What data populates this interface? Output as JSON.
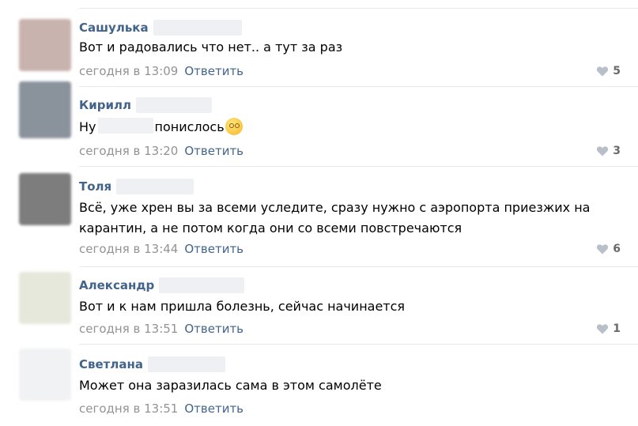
{
  "comments": [
    {
      "author": "Сашулька",
      "text": "Вот и радовались что нет.. а тут за раз",
      "timestamp": "сегодня в 13:09",
      "reply_label": "Ответить",
      "likes": "5",
      "avatar_color": "#c9b3ae"
    },
    {
      "author": "Кирилл",
      "text_before": "Ну",
      "text_after": "понислось",
      "timestamp": "сегодня в 13:20",
      "reply_label": "Ответить",
      "likes": "3",
      "avatar_color": "#8a929c",
      "emoji_icon": "smiling-face-emoji-icon"
    },
    {
      "author": "Толя",
      "text_lines": [
        "Всё, уже хрен вы за всеми уследите, сразу нужно с аэропорта приезжих на",
        "карантин, а не потом когда они со всеми повстречаются"
      ],
      "timestamp": "сегодня в 13:44",
      "reply_label": "Ответить",
      "likes": "6",
      "avatar_color": "#7d7d7d"
    },
    {
      "author": "Александр",
      "text": "Вот и к нам пришла болезнь, сейчас начинается",
      "timestamp": "сегодня в 13:51",
      "reply_label": "Ответить",
      "likes": "1",
      "avatar_color": "#e6e8dc"
    },
    {
      "author": "Светлана",
      "text": "Может она заразилась сама в этом самолёте",
      "timestamp": "сегодня в 13:51",
      "reply_label": "Ответить",
      "avatar_color": "#f1f2f4"
    }
  ],
  "icons": {
    "like": "heart-icon"
  },
  "colors": {
    "author": "#42648b",
    "link": "#42648b",
    "meta": "#939393",
    "divider": "#e7e8ec"
  }
}
